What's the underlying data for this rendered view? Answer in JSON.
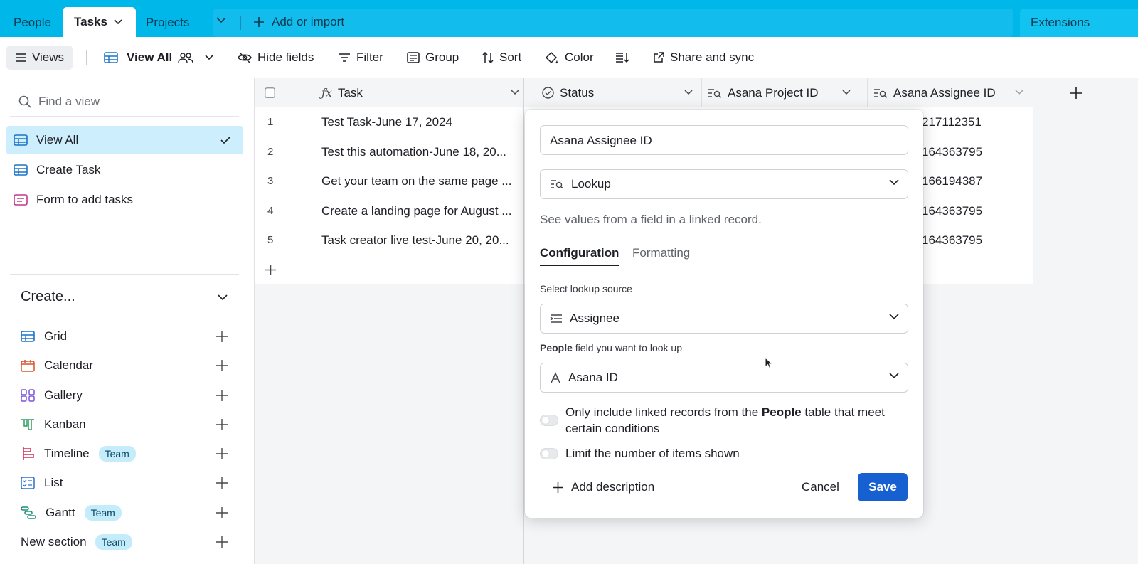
{
  "topbar": {
    "tabs": [
      "People",
      "Tasks",
      "Projects"
    ],
    "add_or_import": "Add or import",
    "extensions": "Extensions"
  },
  "toolbar": {
    "views": "Views",
    "view_name": "View All",
    "hide_fields": "Hide fields",
    "filter": "Filter",
    "group": "Group",
    "sort": "Sort",
    "color": "Color",
    "share_sync": "Share and sync"
  },
  "sidebar": {
    "search_placeholder": "Find a view",
    "views": [
      "View All",
      "Create Task",
      "Form to add tasks"
    ],
    "create_heading": "Create...",
    "create_items": [
      "Grid",
      "Calendar",
      "Gallery",
      "Kanban",
      "Timeline",
      "List",
      "Gantt",
      "New section"
    ],
    "team_badge": "Team"
  },
  "grid": {
    "columns": [
      "Task",
      "Status",
      "Asana Project ID",
      "Asana Assignee ID"
    ],
    "rows": [
      {
        "num": "1",
        "task": "Test Task-June 17, 2024",
        "assignee": "217112351"
      },
      {
        "num": "2",
        "task": "Test this automation-June 18, 20...",
        "assignee": "164363795"
      },
      {
        "num": "3",
        "task": "Get your team on the same page ...",
        "assignee": "166194387"
      },
      {
        "num": "4",
        "task": "Create a landing page for August ...",
        "assignee": "164363795"
      },
      {
        "num": "5",
        "task": "Task creator live test-June 20, 20...",
        "assignee": "164363795"
      }
    ]
  },
  "popover": {
    "field_name": "Asana Assignee ID",
    "field_type": "Lookup",
    "help": "See values from a field in a linked record.",
    "tab_config": "Configuration",
    "tab_format": "Formatting",
    "lookup_source_label": "Select lookup source",
    "lookup_source": "Assignee",
    "field_label_bold": "People",
    "field_label_rest": " field you want to look up",
    "lookup_field": "Asana ID",
    "opt1_a": "Only include linked records from the ",
    "opt1_b": "People",
    "opt1_c": " table that meet certain conditions",
    "opt2": "Limit the number of items shown",
    "add_description": "Add description",
    "cancel": "Cancel",
    "save": "Save"
  },
  "colors": {
    "topbar": "#00b7ea",
    "selected_view": "#cdeefc",
    "save_button": "#1760d2"
  }
}
